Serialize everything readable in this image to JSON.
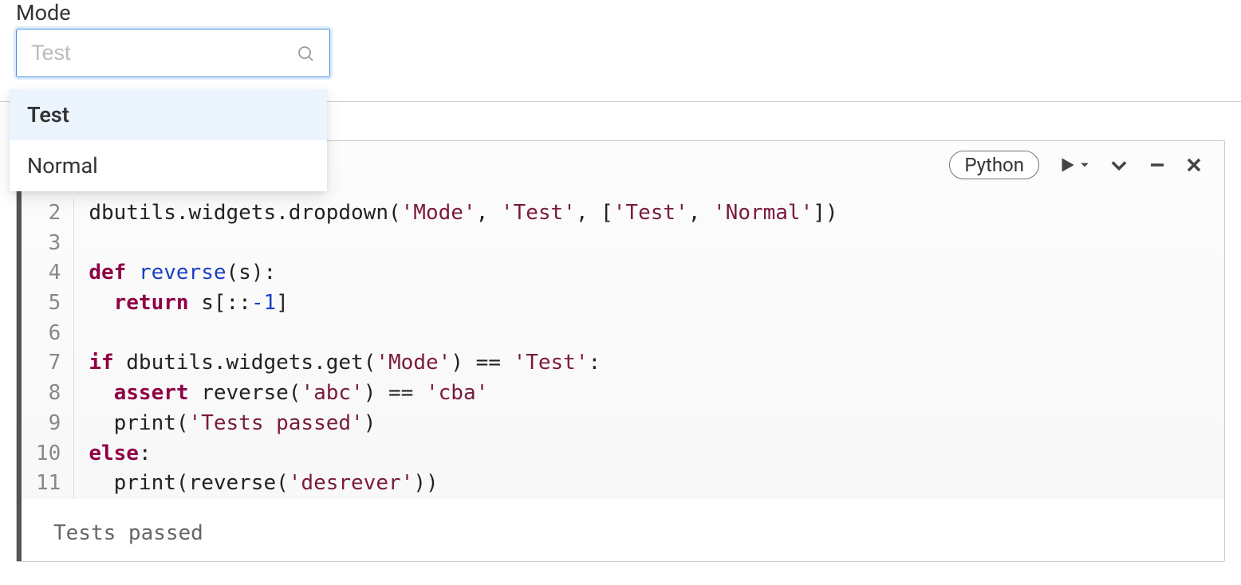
{
  "widget": {
    "label": "Mode",
    "placeholder": "Test",
    "options": [
      "Test",
      "Normal"
    ],
    "selected_index": 0
  },
  "cell": {
    "language": "Python",
    "line_numbers": [
      "2",
      "3",
      "4",
      "5",
      "6",
      "7",
      "8",
      "9",
      "10",
      "11"
    ],
    "code_tokens": [
      [
        {
          "t": "dbutils.widgets.dropdown(",
          "c": "tok-call"
        },
        {
          "t": "'Mode'",
          "c": "tok-str"
        },
        {
          "t": ", ",
          "c": "tok-call"
        },
        {
          "t": "'Test'",
          "c": "tok-str"
        },
        {
          "t": ", [",
          "c": "tok-call"
        },
        {
          "t": "'Test'",
          "c": "tok-str"
        },
        {
          "t": ", ",
          "c": "tok-call"
        },
        {
          "t": "'Normal'",
          "c": "tok-str"
        },
        {
          "t": "])",
          "c": "tok-call"
        }
      ],
      [],
      [
        {
          "t": "def ",
          "c": "tok-kw"
        },
        {
          "t": "reverse",
          "c": "tok-fn"
        },
        {
          "t": "(s):",
          "c": "tok-call"
        }
      ],
      [
        {
          "t": "  ",
          "c": "tok-call"
        },
        {
          "t": "return",
          "c": "tok-kw"
        },
        {
          "t": " s[::",
          "c": "tok-call"
        },
        {
          "t": "-1",
          "c": "tok-num"
        },
        {
          "t": "]",
          "c": "tok-call"
        }
      ],
      [],
      [
        {
          "t": "if",
          "c": "tok-kw"
        },
        {
          "t": " dbutils.widgets.get(",
          "c": "tok-call"
        },
        {
          "t": "'Mode'",
          "c": "tok-str"
        },
        {
          "t": ") == ",
          "c": "tok-call"
        },
        {
          "t": "'Test'",
          "c": "tok-str"
        },
        {
          "t": ":",
          "c": "tok-call"
        }
      ],
      [
        {
          "t": "  ",
          "c": "tok-call"
        },
        {
          "t": "assert",
          "c": "tok-kw"
        },
        {
          "t": " reverse(",
          "c": "tok-call"
        },
        {
          "t": "'abc'",
          "c": "tok-str"
        },
        {
          "t": ") == ",
          "c": "tok-call"
        },
        {
          "t": "'cba'",
          "c": "tok-str"
        }
      ],
      [
        {
          "t": "  print(",
          "c": "tok-call"
        },
        {
          "t": "'Tests passed'",
          "c": "tok-str"
        },
        {
          "t": ")",
          "c": "tok-call"
        }
      ],
      [
        {
          "t": "else",
          "c": "tok-kw"
        },
        {
          "t": ":",
          "c": "tok-call"
        }
      ],
      [
        {
          "t": "  print(reverse(",
          "c": "tok-call"
        },
        {
          "t": "'desrever'",
          "c": "tok-str"
        },
        {
          "t": "))",
          "c": "tok-call"
        }
      ]
    ],
    "output": "Tests passed"
  }
}
